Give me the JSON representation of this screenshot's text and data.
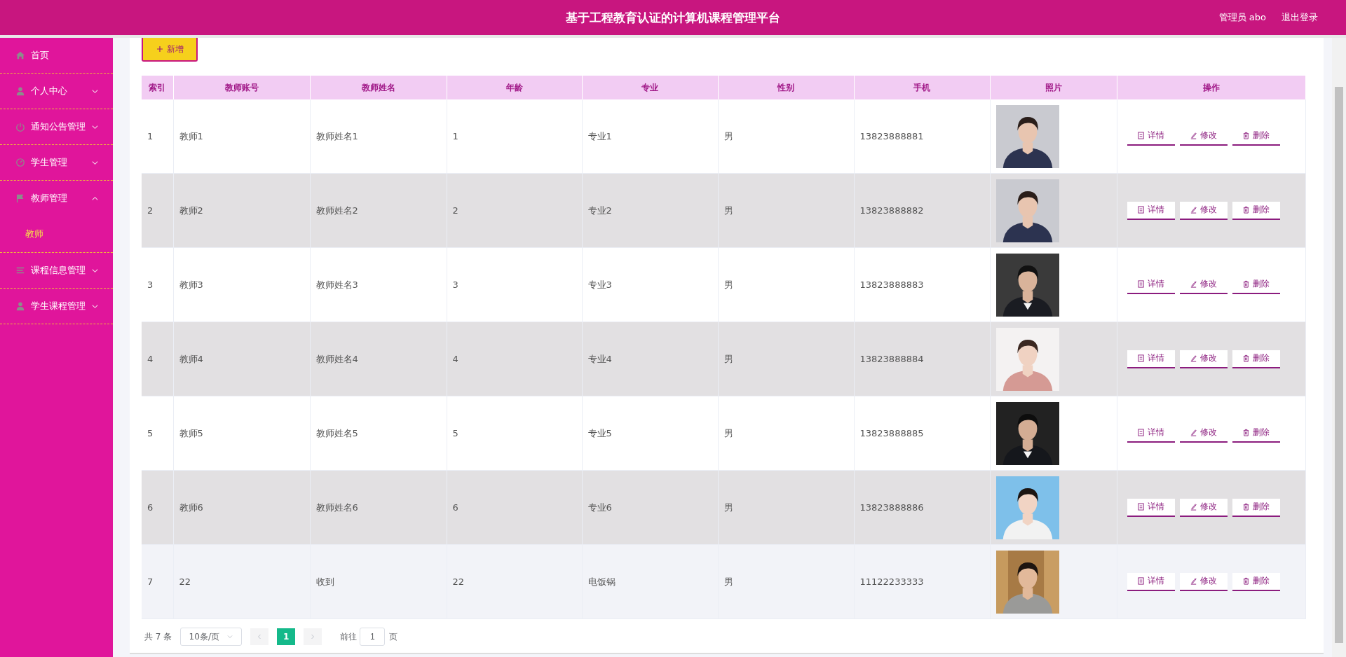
{
  "header": {
    "title": "基于工程教育认证的计算机课程管理平台",
    "user": "管理员 abo",
    "logout": "退出登录"
  },
  "sidebar": {
    "items": [
      {
        "label": "首页",
        "selected": false
      },
      {
        "label": "个人中心",
        "selected": false,
        "expanded": false
      },
      {
        "label": "通知公告管理",
        "selected": false,
        "expanded": false
      },
      {
        "label": "学生管理",
        "selected": false,
        "expanded": false
      },
      {
        "label": "教师管理",
        "selected": false,
        "expanded": true,
        "children": [
          {
            "label": "教师",
            "selected": true
          }
        ]
      },
      {
        "label": "课程信息管理",
        "selected": false,
        "expanded": false
      },
      {
        "label": "学生课程管理",
        "selected": false,
        "expanded": false
      }
    ]
  },
  "toolbar": {
    "add_button": "新增"
  },
  "table": {
    "columns": [
      "索引",
      "教师账号",
      "教师姓名",
      "年龄",
      "专业",
      "性别",
      "手机",
      "照片",
      "操作"
    ],
    "rows": [
      {
        "index": "1",
        "account": "教师1",
        "name": "教师姓名1",
        "age": "1",
        "major": "专业1",
        "gender": "男",
        "phone": "13823888881",
        "actions": [
          "详情",
          "修改",
          "删除"
        ],
        "hovered": false
      },
      {
        "index": "2",
        "account": "教师2",
        "name": "教师姓名2",
        "age": "2",
        "major": "专业2",
        "gender": "男",
        "phone": "13823888882",
        "actions": [
          "详情",
          "修改",
          "删除"
        ],
        "hovered": false
      },
      {
        "index": "3",
        "account": "教师3",
        "name": "教师姓名3",
        "age": "3",
        "major": "专业3",
        "gender": "男",
        "phone": "13823888883",
        "actions": [
          "详情",
          "修改",
          "删除"
        ],
        "hovered": false
      },
      {
        "index": "4",
        "account": "教师4",
        "name": "教师姓名4",
        "age": "4",
        "major": "专业4",
        "gender": "男",
        "phone": "13823888884",
        "actions": [
          "详情",
          "修改",
          "删除"
        ],
        "hovered": false
      },
      {
        "index": "5",
        "account": "教师5",
        "name": "教师姓名5",
        "age": "5",
        "major": "专业5",
        "gender": "男",
        "phone": "13823888885",
        "actions": [
          "详情",
          "修改",
          "删除"
        ],
        "hovered": false
      },
      {
        "index": "6",
        "account": "教师6",
        "name": "教师姓名6",
        "age": "6",
        "major": "专业6",
        "gender": "男",
        "phone": "13823888886",
        "actions": [
          "详情",
          "修改",
          "删除"
        ],
        "hovered": false
      },
      {
        "index": "7",
        "account": "22",
        "name": "收到",
        "age": "22",
        "major": "电饭锅",
        "gender": "男",
        "phone": "11122233333",
        "actions": [
          "详情",
          "修改",
          "删除"
        ],
        "hovered": true
      }
    ]
  },
  "pagination": {
    "total": "共 7 条",
    "page_size": "10条/页",
    "pages": [
      {
        "label": "1",
        "selected": true
      }
    ],
    "goto_label": "前往",
    "goto_value": "1",
    "goto_suffix": "页"
  }
}
